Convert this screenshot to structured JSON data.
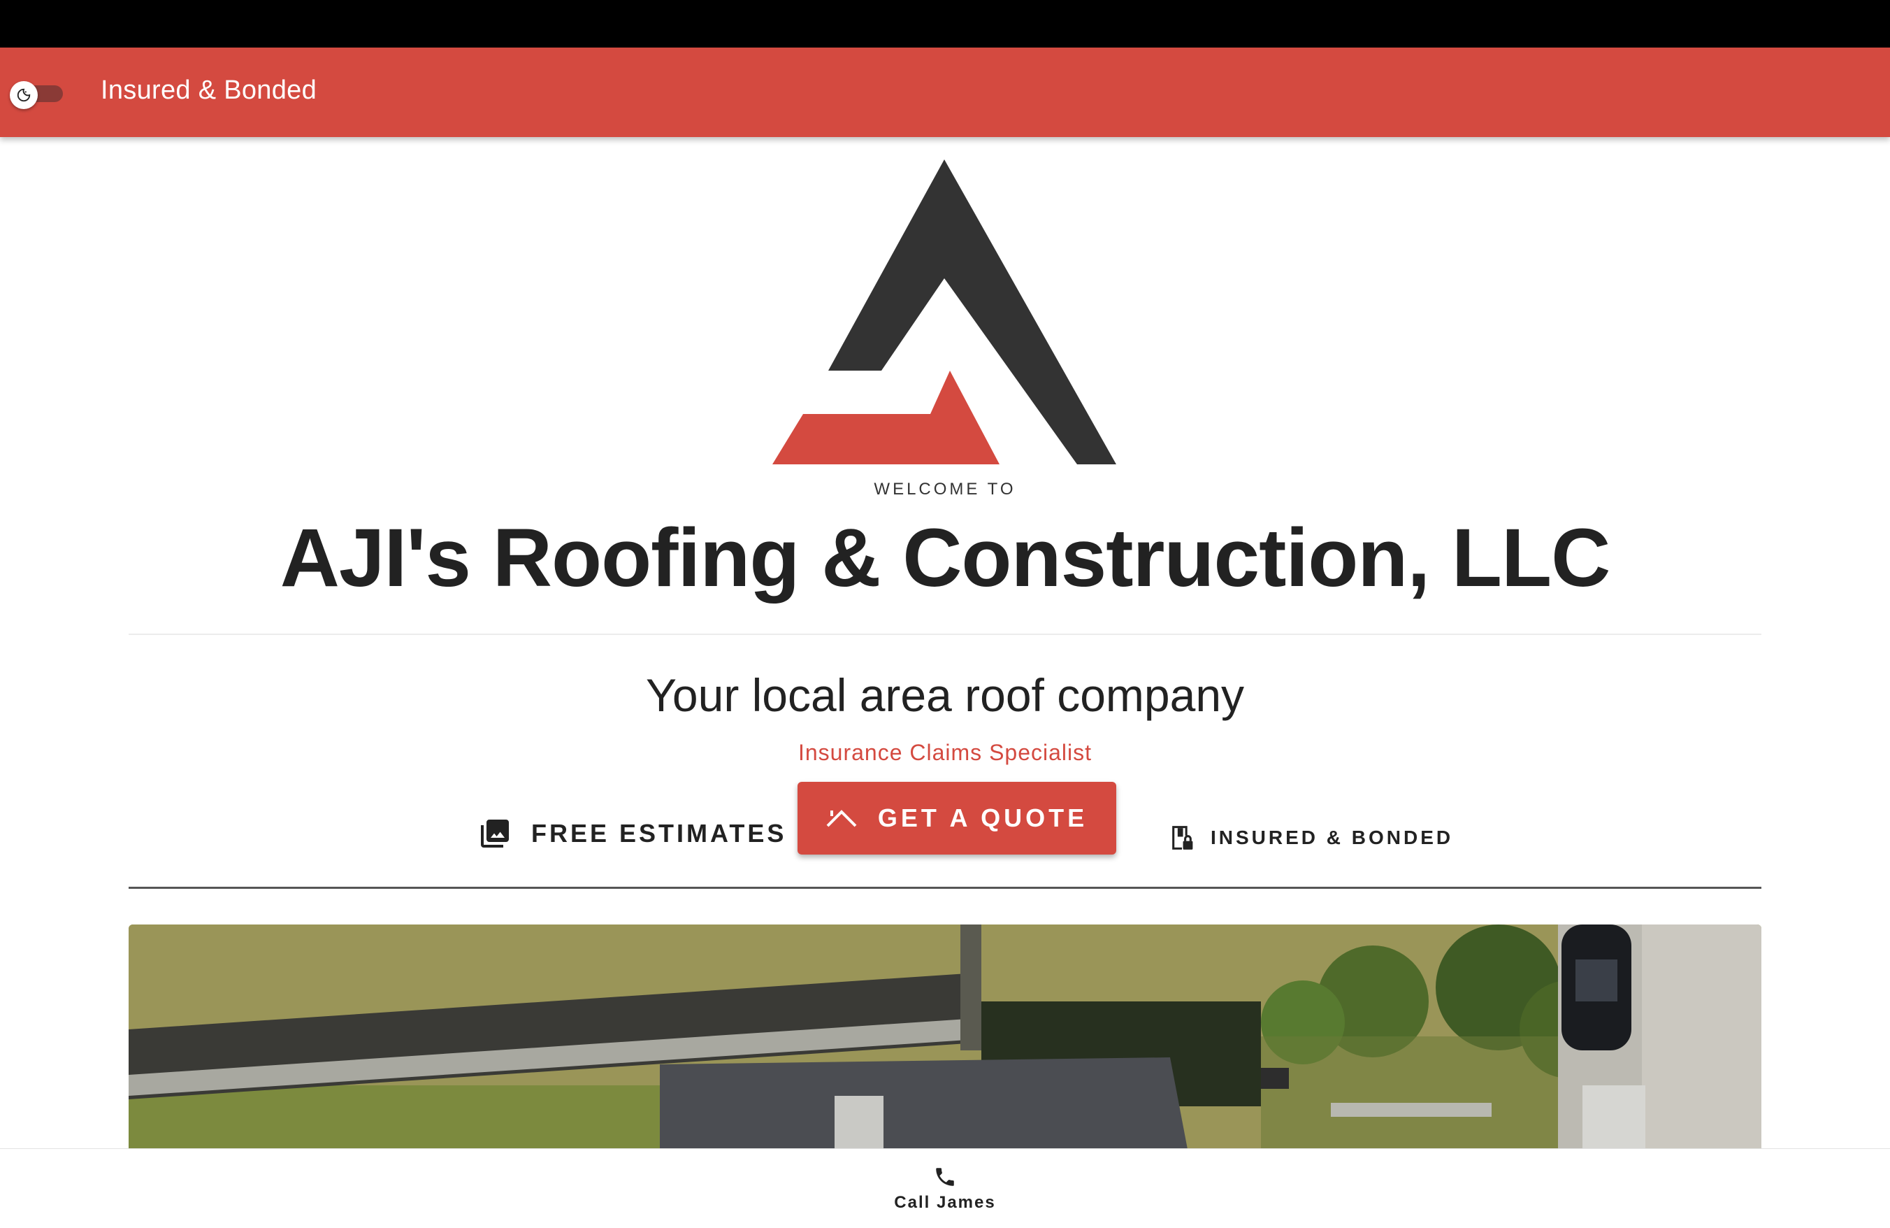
{
  "colors": {
    "brand_red": "#d44a40",
    "dark": "#333333"
  },
  "appbar": {
    "title": "Insured & Bonded",
    "toggle_icon": "dark-mode-icon"
  },
  "header": {
    "welcome": "WELCOME TO",
    "company_name": "AJI's Roofing & Construction, LLC",
    "tagline": "Your local area roof company",
    "subtagline": "Insurance Claims Specialist"
  },
  "actions": {
    "free_estimates": {
      "label": "FREE ESTIMATES",
      "icon": "photo-library-icon"
    },
    "get_quote": {
      "label": "GET A QUOTE",
      "icon": "roof-icon"
    },
    "insured": {
      "label": "INSURED & BONDED",
      "icon": "badge-lock-icon"
    }
  },
  "hero": {
    "image": "aerial-roof-photo"
  },
  "bottom_nav": {
    "call_label": "Call James",
    "call_icon": "phone-icon"
  }
}
